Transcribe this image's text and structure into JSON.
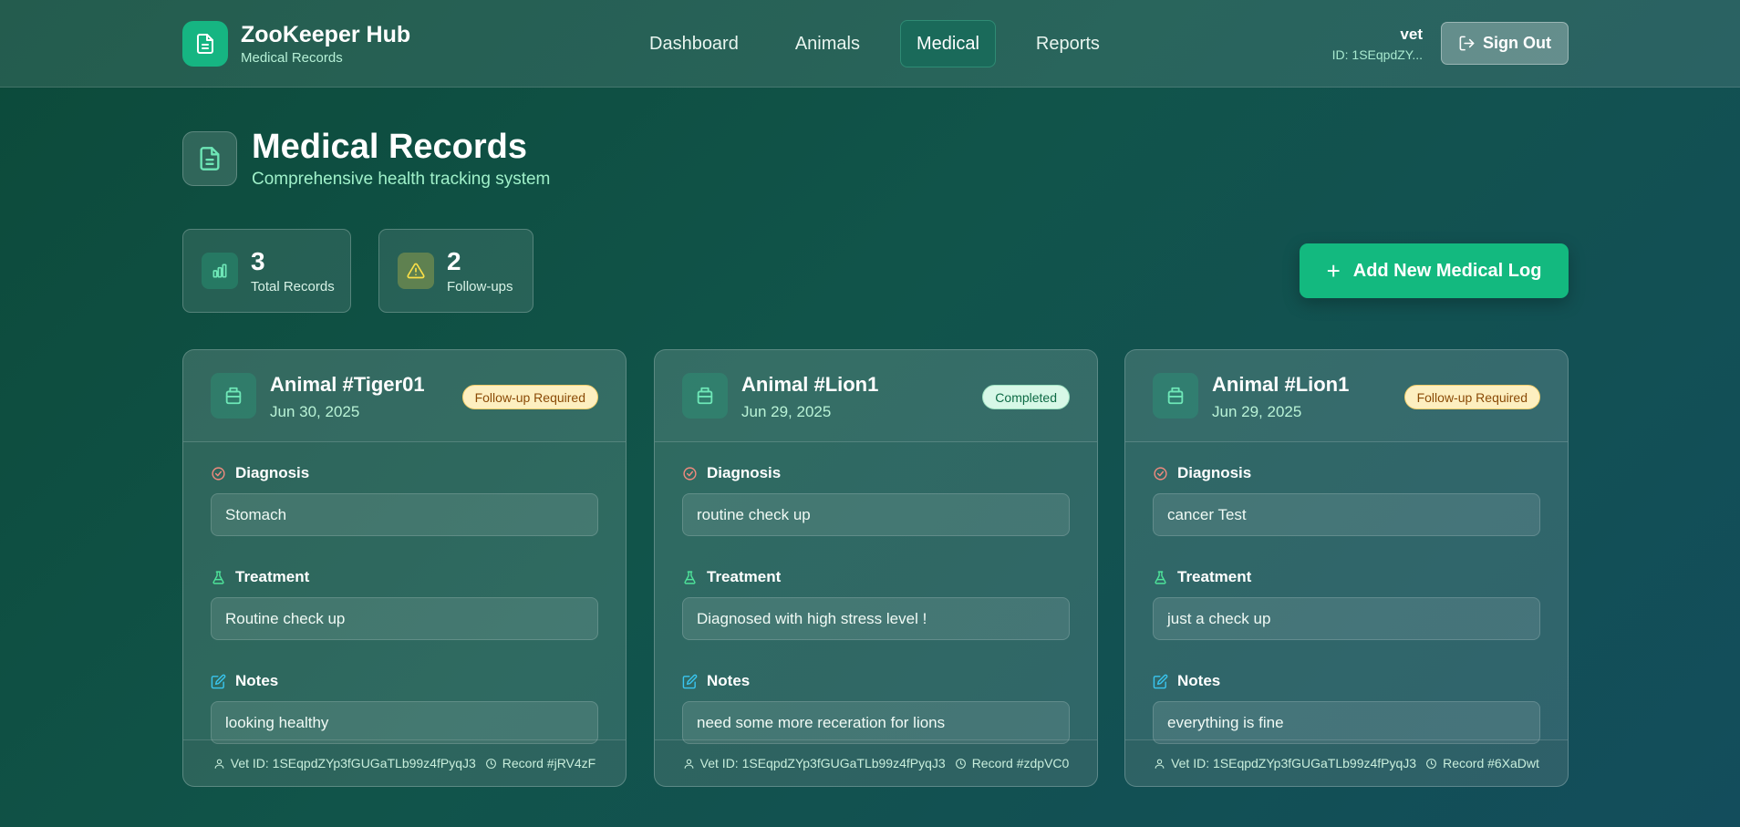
{
  "header": {
    "brand_title": "ZooKeeper Hub",
    "brand_subtitle": "Medical Records",
    "nav": [
      "Dashboard",
      "Animals",
      "Medical",
      "Reports"
    ],
    "active_nav": "Medical",
    "user_name": "vet",
    "user_id": "ID: 1SEqpdZY...",
    "sign_out_label": "Sign Out"
  },
  "page": {
    "title": "Medical Records",
    "subtitle": "Comprehensive health tracking system"
  },
  "stats": [
    {
      "value": "3",
      "label": "Total Records",
      "icon": "bar-chart-icon"
    },
    {
      "value": "2",
      "label": "Follow-ups",
      "icon": "warning-icon"
    }
  ],
  "add_button_label": "Add New Medical Log",
  "field_labels": {
    "diagnosis": "Diagnosis",
    "treatment": "Treatment",
    "notes": "Notes"
  },
  "records": [
    {
      "animal": "Animal #Tiger01",
      "date": "Jun 30, 2025",
      "status": "Follow-up Required",
      "diagnosis": "Stomach",
      "treatment": "Routine check up",
      "notes": "looking healthy",
      "vet_id": "Vet ID: 1SEqpdZYp3fGUGaTLb99z4fPyqJ3",
      "record_id": "Record #jRV4zF"
    },
    {
      "animal": "Animal #Lion1",
      "date": "Jun 29, 2025",
      "status": "Completed",
      "diagnosis": "routine check up",
      "treatment": "Diagnosed with high stress level !",
      "notes": "need some more receration for lions",
      "vet_id": "Vet ID: 1SEqpdZYp3fGUGaTLb99z4fPyqJ3",
      "record_id": "Record #zdpVC0"
    },
    {
      "animal": "Animal #Lion1",
      "date": "Jun 29, 2025",
      "status": "Follow-up Required",
      "diagnosis": "cancer Test",
      "treatment": "just a check up",
      "notes": "everything is fine",
      "vet_id": "Vet ID: 1SEqpdZYp3fGUGaTLb99z4fPyqJ3",
      "record_id": "Record #6XaDwt"
    }
  ],
  "colors": {
    "accent": "#13b97f",
    "follow_badge_bg": "#fdefc0",
    "completed_badge_bg": "#d7f8e7",
    "diagnosis_icon": "#f08a7e",
    "treatment_icon": "#4ee39a",
    "notes_icon": "#39c6f0"
  }
}
